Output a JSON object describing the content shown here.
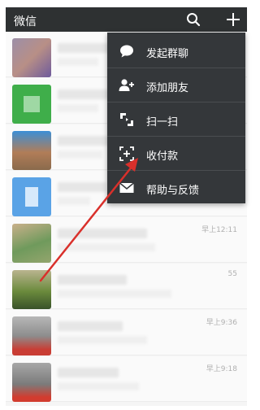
{
  "header": {
    "title": "微信",
    "search_icon": "search-icon",
    "add_icon": "plus-icon"
  },
  "menu": {
    "items": [
      {
        "label": "发起群聊",
        "icon": "chat-bubble-icon"
      },
      {
        "label": "添加朋友",
        "icon": "add-friend-icon"
      },
      {
        "label": "扫一扫",
        "icon": "scan-icon"
      },
      {
        "label": "收付款",
        "icon": "payment-icon"
      },
      {
        "label": "帮助与反馈",
        "icon": "mail-icon"
      }
    ]
  },
  "chats": [
    {
      "time": ""
    },
    {
      "time": ""
    },
    {
      "time": ""
    },
    {
      "time": ""
    },
    {
      "time": "早上12:11"
    },
    {
      "time": "55"
    },
    {
      "time": "早上9:36"
    },
    {
      "time": "早上9:18"
    }
  ],
  "colors": {
    "topbar": "#2e3132",
    "menu_bg": "#34373a",
    "annotation_arrow": "#d9302b"
  }
}
